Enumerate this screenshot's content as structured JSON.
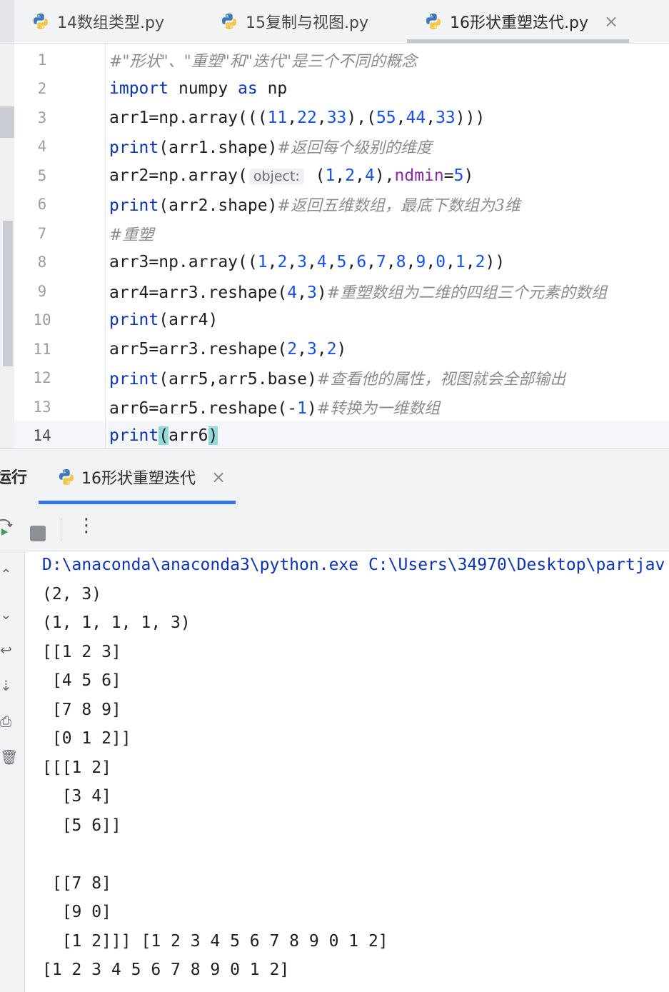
{
  "editor_tabs": [
    {
      "label": "14数组类型.py",
      "icon": "python-icon",
      "active": false
    },
    {
      "label": "15复制与视图.py",
      "icon": "python-icon",
      "active": false
    },
    {
      "label": "16形状重塑迭代.py",
      "icon": "python-icon",
      "active": true
    }
  ],
  "editor": {
    "line_numbers": [
      "1",
      "2",
      "3",
      "4",
      "5",
      "6",
      "7",
      "8",
      "9",
      "10",
      "11",
      "12",
      "13",
      "14"
    ],
    "current_line": 14,
    "lines": [
      {
        "comment": "#\"形状\"、\"重塑\"和\"迭代\"是三个不同的概念"
      },
      {
        "kw": "import",
        "a": " numpy ",
        "kw2": "as",
        "b": " np"
      },
      {
        "a": "arr1=np.array(((",
        "n1": "11",
        "c1": ",",
        "n2": "22",
        "c2": ",",
        "n3": "33",
        "c3": "),(",
        "n4": "55",
        "c4": ",",
        "n5": "44",
        "c5": ",",
        "n6": "33",
        "c6": ")))"
      },
      {
        "fn": "print",
        "a": "(arr1.shape)",
        "comment": "#返回每个级别的维度"
      },
      {
        "a": "arr2=np.array(",
        "hint": "object:",
        "b": " (",
        "n1": "1",
        "c1": ",",
        "n2": "2",
        "c2": ",",
        "n3": "4",
        "c3": "),",
        "param": "ndmin",
        "eq": "=",
        "n4": "5",
        "c4": ")"
      },
      {
        "fn": "print",
        "a": "(arr2.shape)",
        "comment": "#返回五维数组，最底下数组为3维"
      },
      {
        "comment": "#重塑"
      },
      {
        "a": "arr3=np.array((",
        "nums": [
          "1",
          "2",
          "3",
          "4",
          "5",
          "6",
          "7",
          "8",
          "9",
          "0",
          "1",
          "2"
        ],
        "b": "))"
      },
      {
        "a": "arr4=arr3.reshape(",
        "n1": "4",
        "c1": ",",
        "n2": "3",
        "c2": ")",
        "comment": "#重塑数组为二维的四组三个元素的数组"
      },
      {
        "fn": "print",
        "a": "(arr4)"
      },
      {
        "a": "arr5=arr3.reshape(",
        "n1": "2",
        "c1": ",",
        "n2": "3",
        "c2": ",",
        "n3": "2",
        "c3": ")"
      },
      {
        "fn": "print",
        "a": "(arr5,arr5.base)",
        "comment": "#查看他的属性，视图就会全部输出"
      },
      {
        "a": "arr6=arr5.reshape(-",
        "n1": "1",
        "c1": ")",
        "comment": "#转换为一维数组"
      },
      {
        "fn": "print",
        "a": "(",
        "b": "arr6",
        "c": ")"
      }
    ]
  },
  "run_panel": {
    "title": "运行",
    "tab_label": "16形状重塑迭代",
    "output": [
      "D:\\anaconda\\anaconda3\\python.exe C:\\Users\\34970\\Desktop\\partjav",
      "(2, 3)",
      "(1, 1, 1, 1, 3)",
      "[[1 2 3]",
      " [4 5 6]",
      " [7 8 9]",
      " [0 1 2]]",
      "[[[1 2]",
      "  [3 4]",
      "  [5 6]]",
      "",
      " [[7 8]",
      "  [9 0]",
      "  [1 2]]] [1 2 3 4 5 6 7 8 9 0 1 2]",
      "[1 2 3 4 5 6 7 8 9 0 1 2]"
    ]
  },
  "colors": {
    "keyword": "#0b33b5",
    "number": "#1750eb",
    "comment": "#8c8c8c",
    "param": "#8a2ba8",
    "accent_tab": "#3574f0",
    "brace_match": "#93d9d9"
  }
}
